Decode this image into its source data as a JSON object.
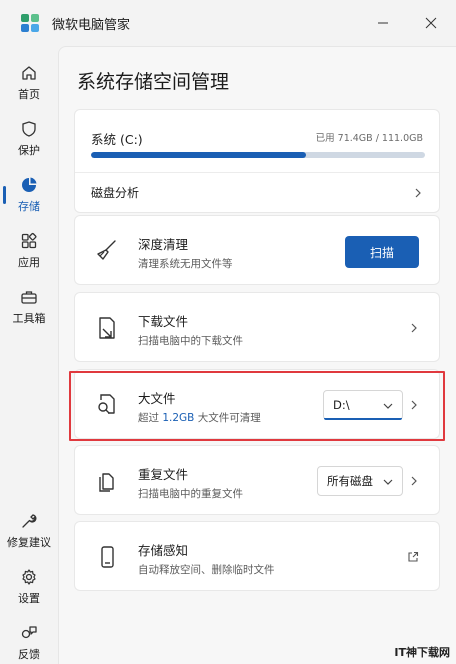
{
  "app": {
    "title": "微软电脑管家"
  },
  "sidebar": {
    "items": [
      {
        "label": "首页",
        "icon": "home-icon"
      },
      {
        "label": "保护",
        "icon": "shield-icon"
      },
      {
        "label": "存储",
        "icon": "pie-chart-icon",
        "active": true
      },
      {
        "label": "应用",
        "icon": "apps-icon"
      },
      {
        "label": "工具箱",
        "icon": "toolbox-icon"
      }
    ],
    "bottom_items": [
      {
        "label": "修复建议",
        "icon": "wrench-icon"
      },
      {
        "label": "设置",
        "icon": "gear-icon"
      },
      {
        "label": "反馈",
        "icon": "feedback-icon"
      }
    ]
  },
  "page": {
    "title": "系统存储空间管理"
  },
  "drive": {
    "name": "系统 (C:)",
    "usage": "已用 71.4GB / 111.0GB",
    "used_fraction": 0.643,
    "analysis_label": "磁盘分析"
  },
  "rows": {
    "deep_clean": {
      "title": "深度清理",
      "subtitle": "清理系统无用文件等",
      "button": "扫描"
    },
    "downloads": {
      "title": "下载文件",
      "subtitle": "扫描电脑中的下载文件"
    },
    "large_files": {
      "title": "大文件",
      "subtitle_prefix": "超过",
      "subtitle_size": "1.2GB",
      "subtitle_suffix": "大文件可清理",
      "drive_select": "D:\\"
    },
    "duplicates": {
      "title": "重复文件",
      "subtitle": "扫描电脑中的重复文件",
      "drive_select": "所有磁盘"
    },
    "storage_sense": {
      "title": "存储感知",
      "subtitle": "自动释放空间、删除临时文件"
    }
  },
  "watermark": "IT神下载网",
  "colors": {
    "accent": "#1a5fb4",
    "highlight": "#e0393e"
  }
}
